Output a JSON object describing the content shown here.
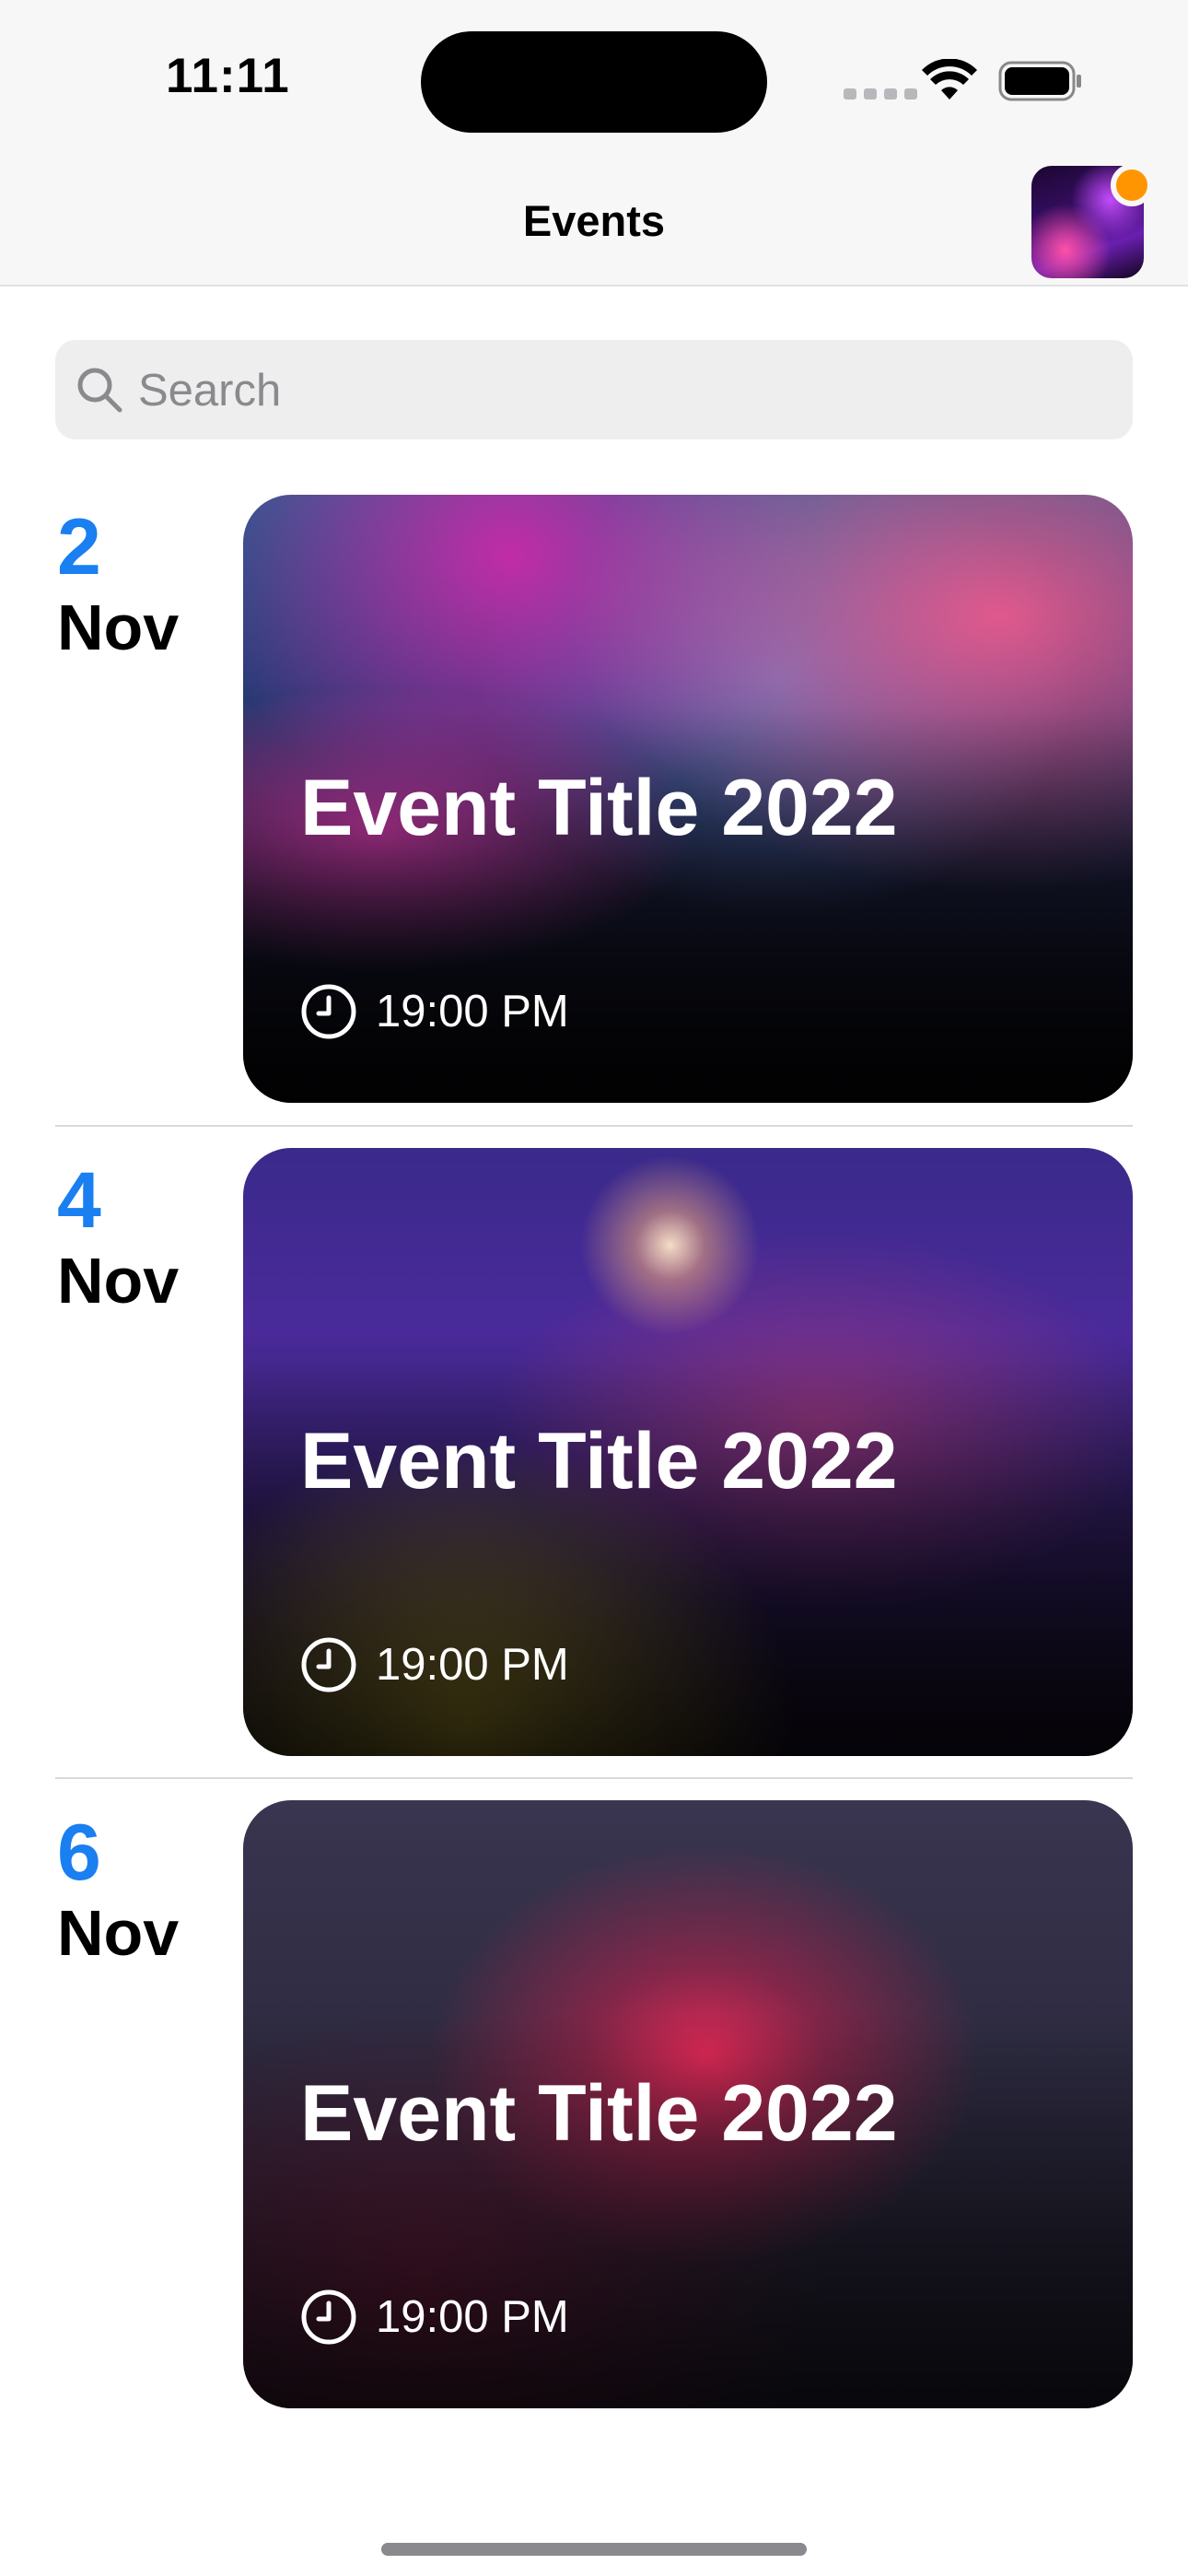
{
  "status_bar": {
    "time": "11:11",
    "icons": [
      "cellular-signal-icon",
      "wifi-icon",
      "battery-icon"
    ]
  },
  "nav": {
    "title": "Events",
    "avatar_badge_color": "#ff9500"
  },
  "search": {
    "placeholder": "Search",
    "value": ""
  },
  "events": [
    {
      "day": "2",
      "month": "Nov",
      "title": "Event Title 2022",
      "time": "19:00 PM"
    },
    {
      "day": "4",
      "month": "Nov",
      "title": "Event Title 2022",
      "time": "19:00 PM"
    },
    {
      "day": "6",
      "month": "Nov",
      "title": "Event Title 2022",
      "time": "19:00 PM"
    }
  ],
  "colors": {
    "accent": "#1a7ff0",
    "badge": "#ff9500",
    "background": "#ffffff"
  }
}
